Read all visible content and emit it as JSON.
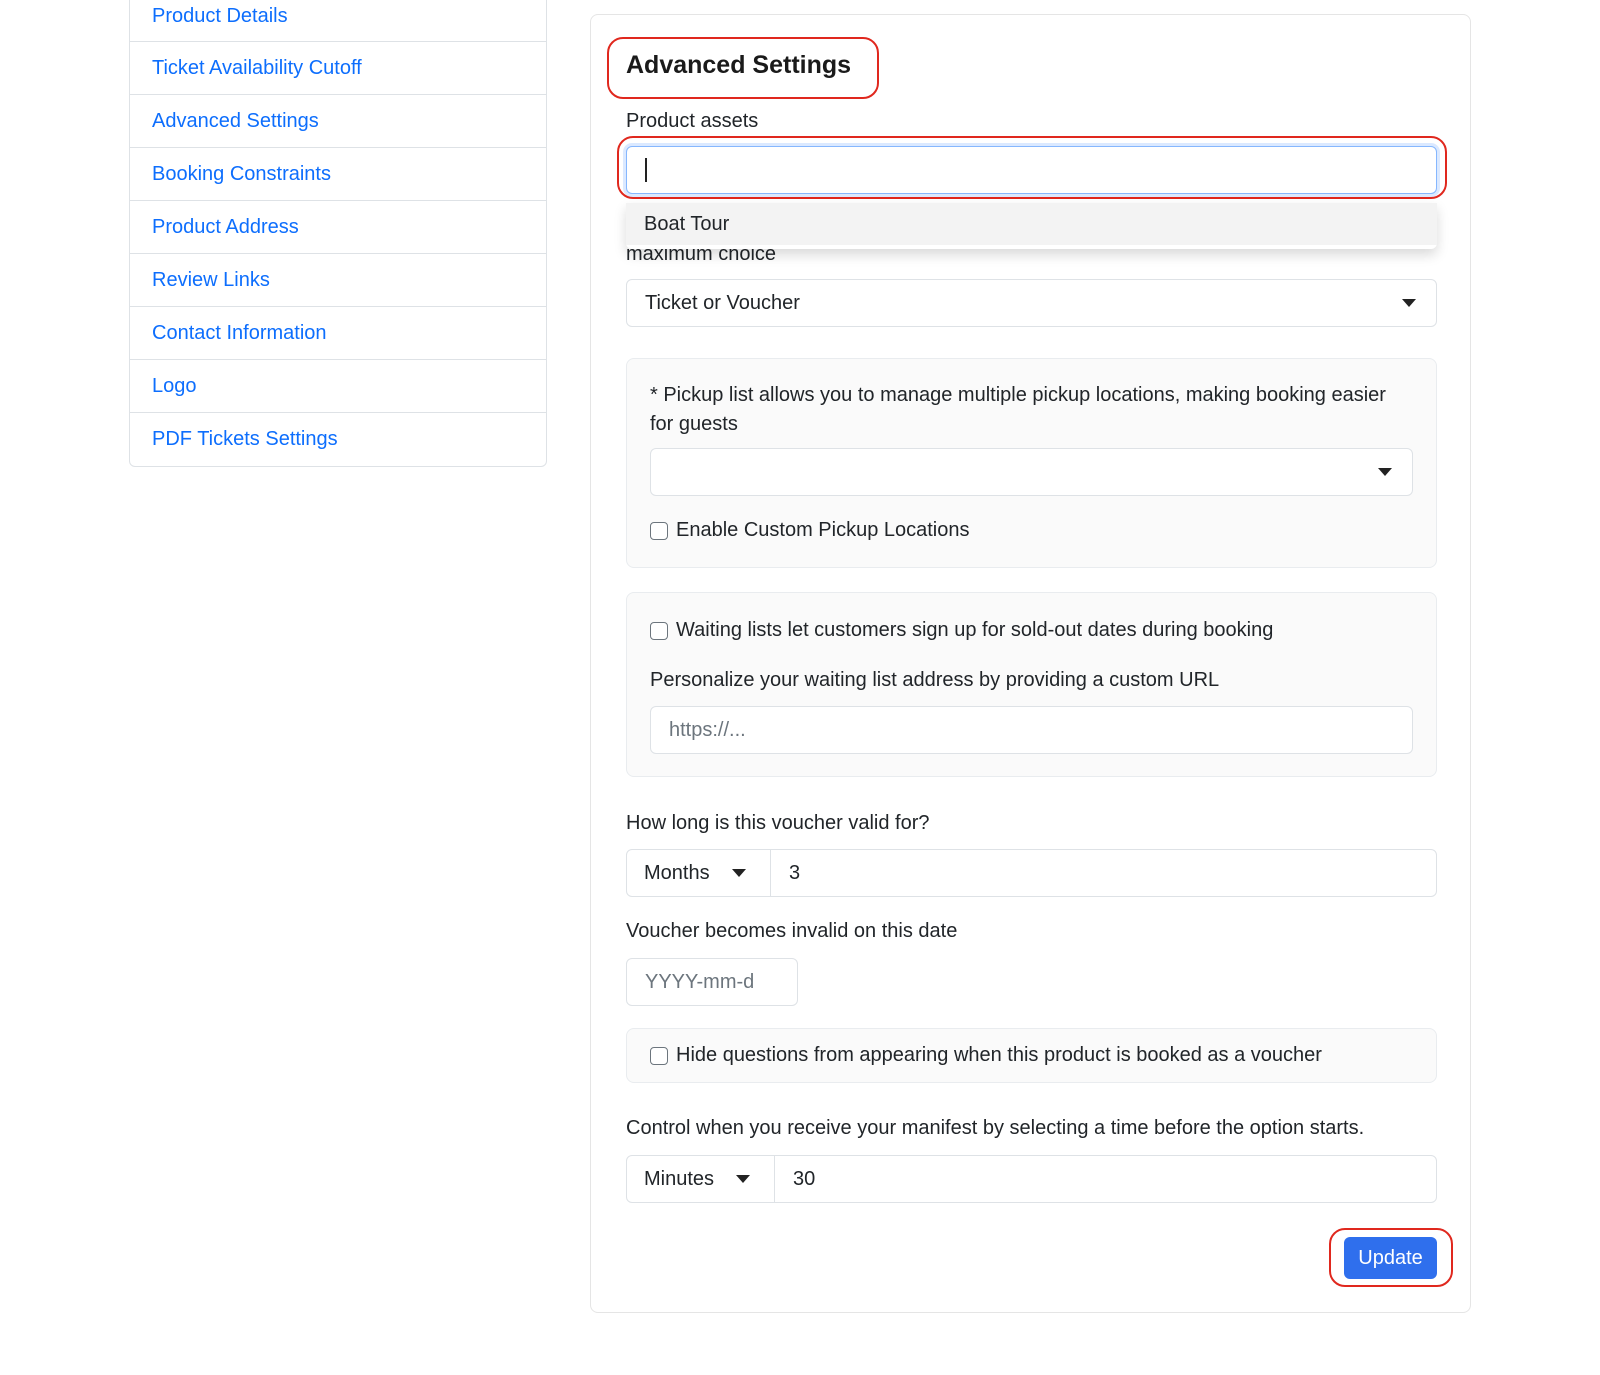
{
  "sidebar": {
    "items": [
      {
        "label": "Product Details"
      },
      {
        "label": "Ticket Availability Cutoff"
      },
      {
        "label": "Advanced Settings"
      },
      {
        "label": "Booking Constraints"
      },
      {
        "label": "Product Address"
      },
      {
        "label": "Review Links"
      },
      {
        "label": "Contact Information"
      },
      {
        "label": "Logo"
      },
      {
        "label": "PDF Tickets Settings"
      }
    ]
  },
  "main": {
    "title": "Advanced Settings",
    "product_assets": {
      "label": "Product assets",
      "value": "",
      "dropdown_options": [
        "Boat Tour"
      ]
    },
    "maximum_choice": {
      "label": "maximum choice",
      "selected": "Ticket or Voucher"
    },
    "pickup": {
      "description": "* Pickup list allows you to manage multiple pickup locations, making booking easier for guests",
      "selected": "",
      "custom_pickup_label": "Enable Custom Pickup Locations",
      "custom_pickup_checked": false
    },
    "waiting_list": {
      "checkbox_label": "Waiting lists let customers sign up for sold-out dates during booking",
      "checked": false,
      "url_label": "Personalize your waiting list address by providing a custom URL",
      "url_placeholder": "https://..."
    },
    "voucher_validity": {
      "label": "How long is this voucher valid for?",
      "unit": "Months",
      "value": "3"
    },
    "voucher_invalid_date": {
      "label": "Voucher becomes invalid on this date",
      "placeholder": "YYYY-mm-d"
    },
    "hide_questions": {
      "label": "Hide questions from appearing when this product is booked as a voucher",
      "checked": false
    },
    "manifest": {
      "label": "Control when you receive your manifest by selecting a time before the option starts.",
      "unit": "Minutes",
      "value": "30"
    },
    "update_button": "Update"
  },
  "colors": {
    "link": "#0d6efd",
    "primary_button": "#2f6fed",
    "highlight_outline": "#e0281e"
  }
}
